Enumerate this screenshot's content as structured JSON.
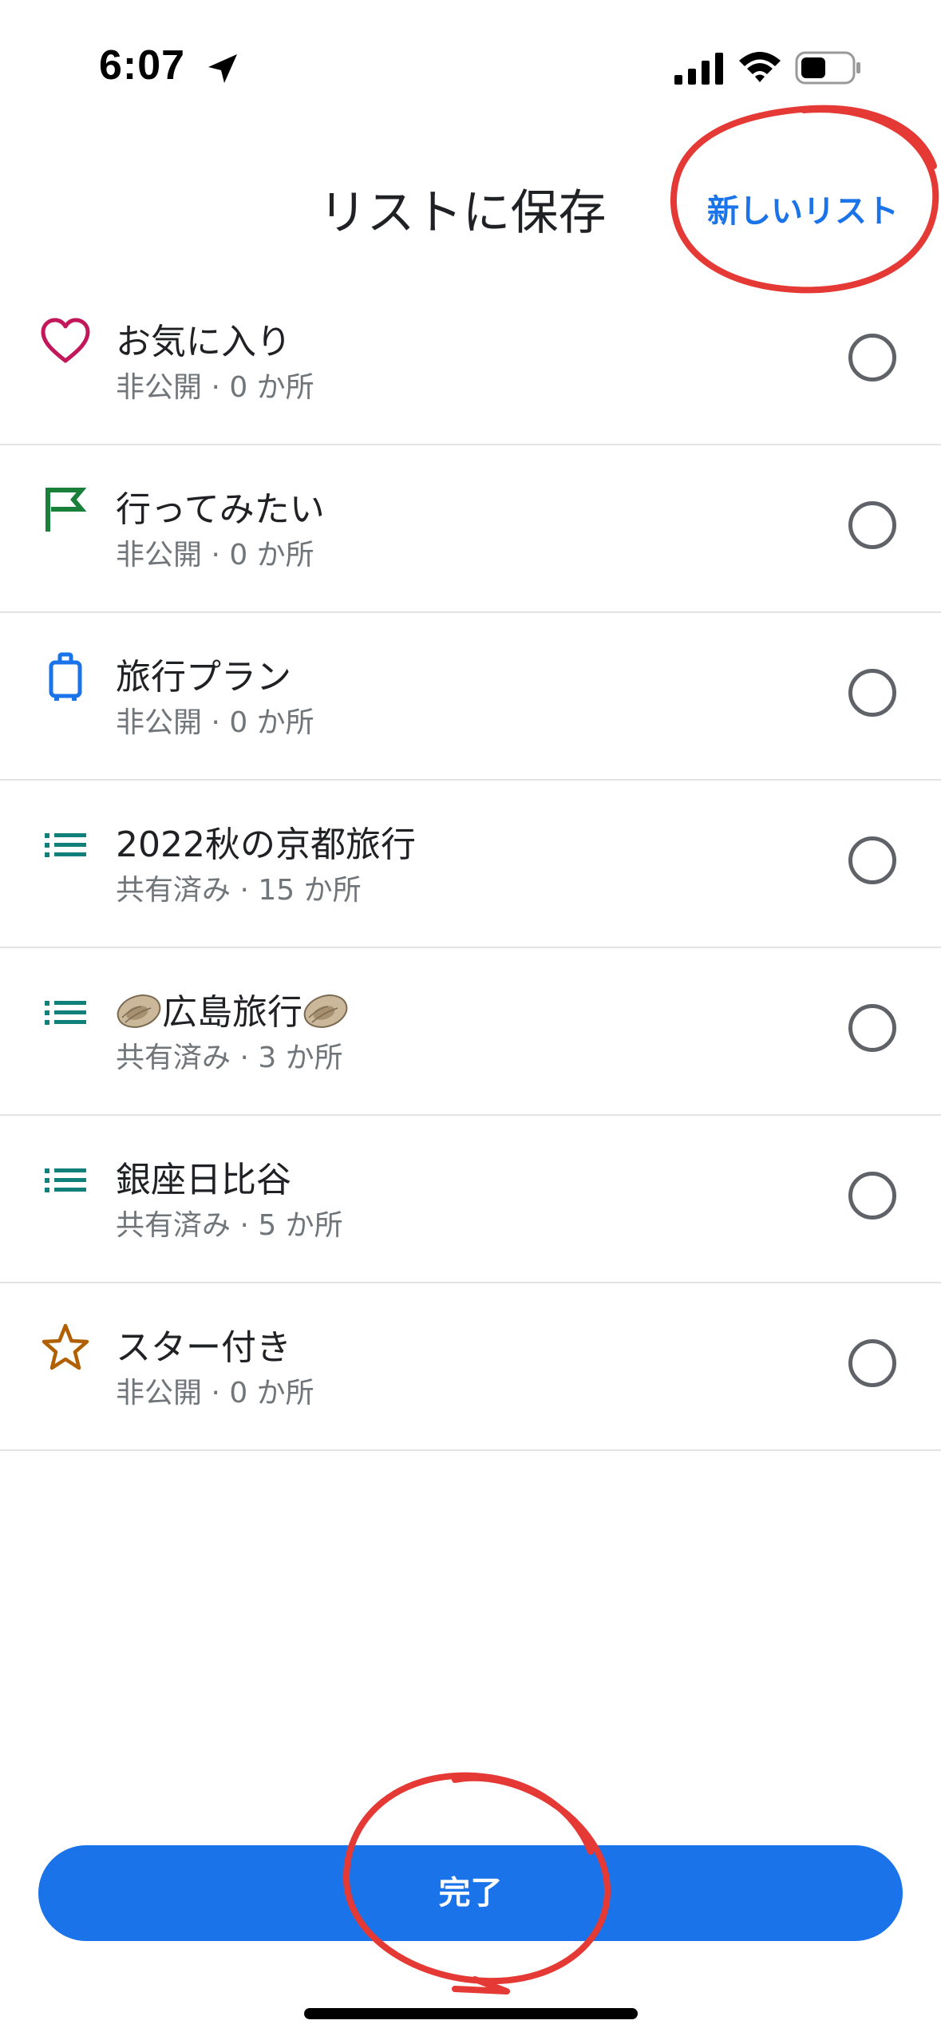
{
  "status_bar": {
    "time": "6:07",
    "icons": [
      "location-arrow-icon",
      "cellular-signal-icon",
      "wifi-icon",
      "battery-icon"
    ]
  },
  "header": {
    "title": "リストに保存",
    "new_list_label": "新しいリスト"
  },
  "lists": [
    {
      "title": "お気に入り",
      "subtitle": "非公開 · 0 か所",
      "icon": "heart-icon",
      "color": "#c2185b",
      "checked": false
    },
    {
      "title": "行ってみたい",
      "subtitle": "非公開 · 0 か所",
      "icon": "flag-icon",
      "color": "#188038",
      "checked": false
    },
    {
      "title": "旅行プラン",
      "subtitle": "非公開 · 0 か所",
      "icon": "suitcase-icon",
      "color": "#1a73e8",
      "checked": false
    },
    {
      "title": "2022秋の京都旅行",
      "subtitle": "共有済み · 15 か所",
      "icon": "list-icon",
      "color": "#12807a",
      "checked": false
    },
    {
      "title_pre": "",
      "title_main": "広島旅行",
      "title_post": "",
      "subtitle": "共有済み · 3 か所",
      "icon": "list-icon",
      "color": "#12807a",
      "decoration": "oyster-emoji",
      "checked": false
    },
    {
      "title": "銀座日比谷",
      "subtitle": "共有済み · 5 か所",
      "icon": "list-icon",
      "color": "#12807a",
      "checked": false
    },
    {
      "title": "スター付き",
      "subtitle": "非公開 · 0 か所",
      "icon": "star-icon",
      "color": "#b06000",
      "checked": false
    }
  ],
  "footer": {
    "done_label": "完了"
  },
  "colors": {
    "accent": "#1a73e8",
    "annotation": "#e53935",
    "divider": "#e3e3e3"
  }
}
